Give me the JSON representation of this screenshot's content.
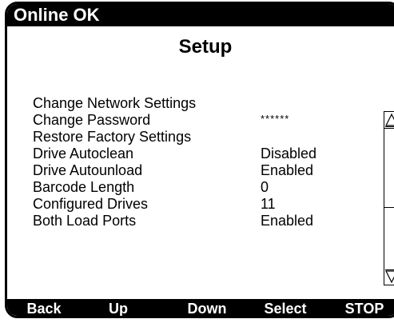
{
  "status": {
    "text": "Online OK"
  },
  "screen": {
    "title": "Setup"
  },
  "menu": {
    "items": [
      {
        "label": "Change Network Settings",
        "value": ""
      },
      {
        "label": "Change Password",
        "value": "******"
      },
      {
        "label": "Restore Factory Settings",
        "value": ""
      },
      {
        "label": "Drive Autoclean",
        "value": "Disabled"
      },
      {
        "label": "Drive Autounload",
        "value": "Enabled"
      },
      {
        "label": "Barcode Length",
        "value": "0"
      },
      {
        "label": "Configured Drives",
        "value": "11"
      },
      {
        "label": "Both Load Ports",
        "value": "Enabled"
      }
    ]
  },
  "scrollbar": {
    "up_icon": "triangle-up-icon",
    "down_icon": "triangle-down-icon"
  },
  "softkeys": [
    {
      "label": "Back"
    },
    {
      "label": "Up"
    },
    {
      "label": "Down"
    },
    {
      "label": "Select"
    },
    {
      "label": "STOP"
    }
  ],
  "colors": {
    "foreground": "#000000",
    "background": "#ffffff"
  }
}
